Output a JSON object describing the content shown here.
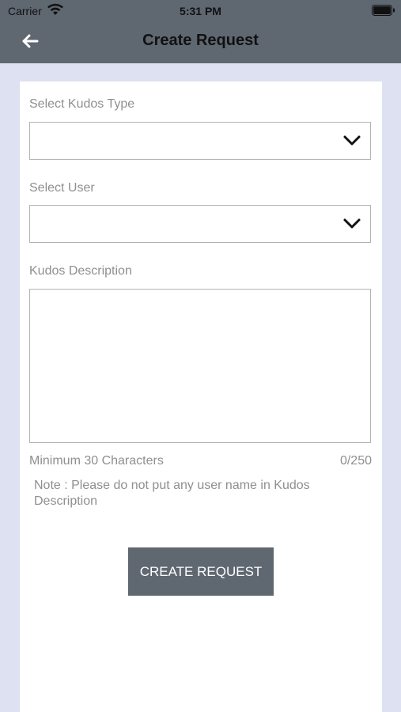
{
  "status_bar": {
    "carrier": "Carrier",
    "time": "5:31 PM"
  },
  "header": {
    "title": "Create Request",
    "back_icon": "arrow-left-icon"
  },
  "form": {
    "kudos_type_label": "Select Kudos Type",
    "kudos_type_value": "",
    "user_label": "Select User",
    "user_value": "",
    "description_label": "Kudos Description",
    "description_value": "",
    "min_chars_text": "Minimum 30 Characters",
    "char_count": "0/250",
    "note": "Note : Please do not put any user name in Kudos Description",
    "submit_label": "CREATE REQUEST"
  },
  "colors": {
    "header_bg": "#5f6771",
    "page_bg": "#dde1f1",
    "button_bg": "#5f6771",
    "label_text": "#8f8f8f"
  }
}
